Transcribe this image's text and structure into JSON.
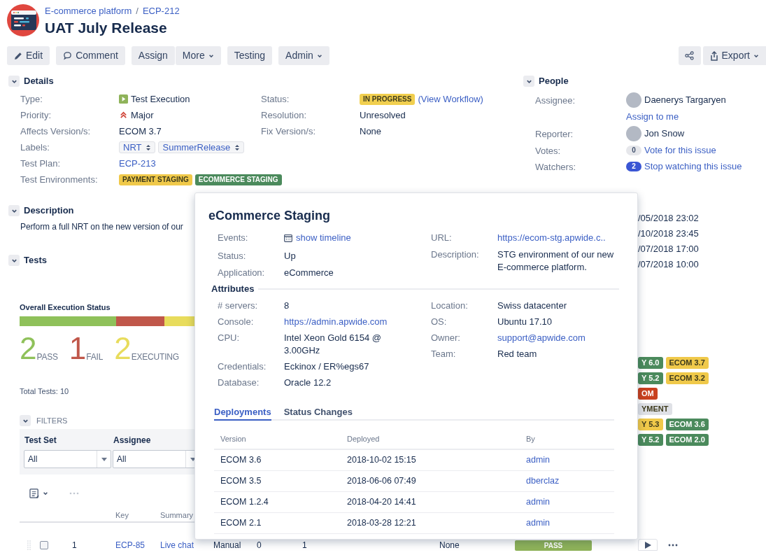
{
  "breadcrumbs": {
    "items": [
      "E-commerce platform",
      "ECP-212"
    ],
    "separator": "/"
  },
  "title": "UAT July Release",
  "toolbar": [
    [
      {
        "label": "Edit",
        "kind": "edit"
      }
    ],
    [
      {
        "label": "Comment",
        "kind": "comment"
      }
    ],
    [
      {
        "label": "Assign",
        "kind": "plain"
      },
      {
        "label": "More",
        "kind": "menu"
      }
    ],
    [
      {
        "label": "Testing",
        "kind": "plain"
      }
    ],
    [
      {
        "label": "Admin",
        "kind": "menu"
      }
    ]
  ],
  "toolbar_right": [
    {
      "kind": "share"
    },
    {
      "label": "Export",
      "kind": "export"
    }
  ],
  "details": {
    "title": "Details",
    "expanded": true,
    "left": [
      {
        "label": "Type:",
        "kind": "type",
        "value": "Test Execution"
      },
      {
        "label": "Priority:",
        "kind": "priority",
        "value": "Major"
      },
      {
        "label": "Affects Version/s:",
        "kind": "text",
        "value": "ECOM 3.7"
      },
      {
        "label": "Labels:",
        "kind": "labels",
        "values": [
          "NRT",
          "SummerRelease"
        ]
      },
      {
        "label": "Test Plan:",
        "kind": "link",
        "value": "ECP-213"
      },
      {
        "label": "Test Environments:",
        "kind": "lozenges",
        "lozenges": [
          {
            "text": "PAYMENT STAGING",
            "color": "#f0c94a"
          },
          {
            "text": "ECOMMERCE STAGING",
            "color": "#4b8a5c"
          }
        ]
      }
    ],
    "right": [
      {
        "label": "Status:",
        "kind": "status",
        "lozenge": {
          "text": "IN PROGRESS",
          "color": "#f1cf4f"
        },
        "link": "(View Workflow)"
      },
      {
        "label": "Resolution:",
        "kind": "text",
        "value": "Unresolved"
      },
      {
        "label": "Fix Version/s:",
        "kind": "text",
        "value": "None"
      }
    ]
  },
  "people": {
    "title": "People",
    "expanded": true,
    "rows": [
      {
        "label": "Assignee:",
        "kind": "user",
        "value": "Daenerys Targaryen",
        "link": "Assign to me"
      },
      {
        "label": "Reporter:",
        "kind": "user",
        "value": "Jon Snow"
      },
      {
        "label": "Votes:",
        "kind": "count",
        "count": "0",
        "highlighted": false,
        "link": "Vote for this issue"
      },
      {
        "label": "Watchers:",
        "kind": "count",
        "count": "2",
        "highlighted": true,
        "link": "Stop watching this issue"
      }
    ]
  },
  "description": {
    "title": "Description",
    "expanded": true,
    "text": "Perform a full NRT on the new version of our"
  },
  "side_dates": [
    "/05/2018 23:02",
    "/10/2018 23:45",
    "/07/2018 17:00",
    "/07/2018 10:00"
  ],
  "tests": {
    "title": "Tests",
    "expanded": true,
    "status_title": "Overall Execution Status",
    "stats": [
      {
        "count": "2",
        "label": "PASS",
        "color": "#8fc15a"
      },
      {
        "count": "1",
        "label": "FAIL",
        "color": "#c0574a"
      },
      {
        "count": "2",
        "label": "EXECUTING",
        "color": "#e8dc5c"
      }
    ],
    "total": "Total Tests: 10",
    "filters": {
      "title": "FILTERS",
      "expanded": true,
      "fields": [
        {
          "label": "Test Set",
          "value": "All"
        },
        {
          "label": "Assignee",
          "value": "All"
        }
      ]
    },
    "columns": [
      "Key",
      "Summary"
    ],
    "rows": [
      {
        "checked": false,
        "index": "1",
        "key": "ECP-85",
        "summary": "Live chat",
        "column_4": "Manual",
        "column_5": "0",
        "column_6": "1",
        "column_7": "None",
        "status": "PASS"
      }
    ]
  },
  "side_tags": [
    [
      {
        "text": "Y 6.0",
        "color": "#4b8a5c"
      },
      {
        "text": "ECOM 3.7",
        "color": "#f0c94a"
      }
    ],
    [
      {
        "text": "Y 5.2",
        "color": "#4b8a5c"
      },
      {
        "text": "ECOM 3.2",
        "color": "#f0c94a"
      }
    ],
    [
      {
        "text": "OM",
        "color": "#c9411f"
      }
    ],
    [
      {
        "text": "YMENT",
        "color": "#dfe1e6"
      }
    ],
    [
      {
        "text": "Y 5.3",
        "color": "#f0c94a"
      },
      {
        "text": "ECOM 3.6",
        "color": "#4b8a5c"
      }
    ],
    [
      {
        "text": "Y 5.2",
        "color": "#4b8a5c"
      },
      {
        "text": "ECOM 2.0",
        "color": "#4b8a5c"
      }
    ]
  ],
  "popup": {
    "title": "eCommerce Staging",
    "info_left": [
      {
        "label": "Events:",
        "kind": "timeline",
        "value": "show timeline"
      },
      {
        "label": "Status:",
        "kind": "text",
        "value": "Up"
      },
      {
        "label": "Application:",
        "kind": "text",
        "value": "eCommerce"
      }
    ],
    "info_right": [
      {
        "label": "URL:",
        "kind": "link",
        "value": "https://ecom-stg.apwide.c.."
      },
      {
        "label": "Description:",
        "kind": "text",
        "value": "STG environment of our new E-commerce platform."
      }
    ],
    "attributes_title": "Attributes",
    "attributes_left": [
      {
        "label": "# servers:",
        "kind": "text",
        "value": "8"
      },
      {
        "label": "Console:",
        "kind": "link",
        "value": "https://admin.apwide.com"
      },
      {
        "label": "CPU:",
        "kind": "text",
        "value": "Intel Xeon Gold 6154 @ 3.00GHz"
      },
      {
        "label": "Credentials:",
        "kind": "text",
        "value": "Eckinox / ER%egs67"
      },
      {
        "label": "Database:",
        "kind": "text",
        "value": "Oracle 12.2"
      }
    ],
    "attributes_right": [
      {
        "label": "Location:",
        "kind": "text",
        "value": "Swiss datacenter"
      },
      {
        "label": "OS:",
        "kind": "text",
        "value": "Ubuntu 17.10"
      },
      {
        "label": "Owner:",
        "kind": "link",
        "value": "support@apwide.com"
      },
      {
        "label": "Team:",
        "kind": "text",
        "value": "Red team"
      }
    ],
    "tabs": [
      {
        "label": "Deployments",
        "selected": true
      },
      {
        "label": "Status Changes",
        "selected": false
      }
    ],
    "table": {
      "columns": [
        "Version",
        "Deployed",
        "By"
      ],
      "rows": [
        [
          "ECOM 3.6",
          "2018-10-02 15:15",
          "admin"
        ],
        [
          "ECOM 3.5",
          "2018-06-06 07:49",
          "dberclaz"
        ],
        [
          "ECOM 1.2.4",
          "2018-04-20 14:41",
          "admin"
        ],
        [
          "ECOM 2.1",
          "2018-03-28 12:21",
          "admin"
        ]
      ]
    }
  }
}
